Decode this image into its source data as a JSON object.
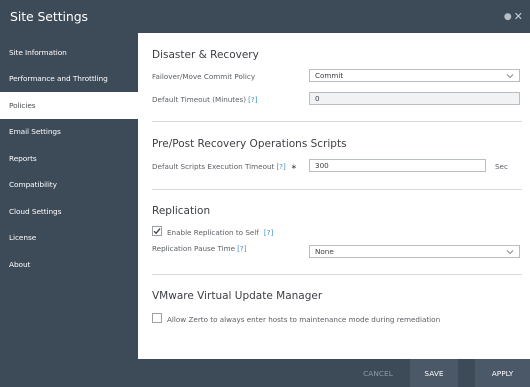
{
  "window": {
    "title": "Site Settings"
  },
  "sidebar": {
    "items": [
      {
        "label": "Site Information"
      },
      {
        "label": "Performance and Throttling"
      },
      {
        "label": "Policies"
      },
      {
        "label": "Email Settings"
      },
      {
        "label": "Reports"
      },
      {
        "label": "Compatibility"
      },
      {
        "label": "Cloud Settings"
      },
      {
        "label": "License"
      },
      {
        "label": "About"
      }
    ],
    "active": "Policies"
  },
  "disaster_recovery": {
    "title": "Disaster & Recovery",
    "failover_label": "Failover/Move Commit Policy",
    "failover_value": "Commit",
    "timeout_label": "Default Timeout (Minutes)",
    "timeout_help": "[?]",
    "timeout_value": "0"
  },
  "scripts": {
    "title": "Pre/Post Recovery Operations Scripts",
    "timeout_label": "Default Scripts Execution Timeout",
    "timeout_help": "[?]",
    "required_mark": "∗",
    "timeout_value": "300",
    "unit": "Sec"
  },
  "replication": {
    "title": "Replication",
    "enable_label": "Enable Replication to Self",
    "enable_help": "[?]",
    "enable_checked": true,
    "pause_label": "Replication Pause Time",
    "pause_help": "[?]",
    "pause_value": "None"
  },
  "vum": {
    "title": "VMware Virtual Update Manager",
    "allow_label": "Allow Zerto to always enter hosts to maintenance mode during remediation",
    "allow_checked": false
  },
  "footer": {
    "cancel_label": "CANCEL",
    "save_label": "SAVE",
    "apply_label": "APPLY"
  },
  "colors": {
    "sidebar_bg": "#3d4a58",
    "help_link": "#3a8fc6",
    "button_bg": "#4a5868"
  }
}
